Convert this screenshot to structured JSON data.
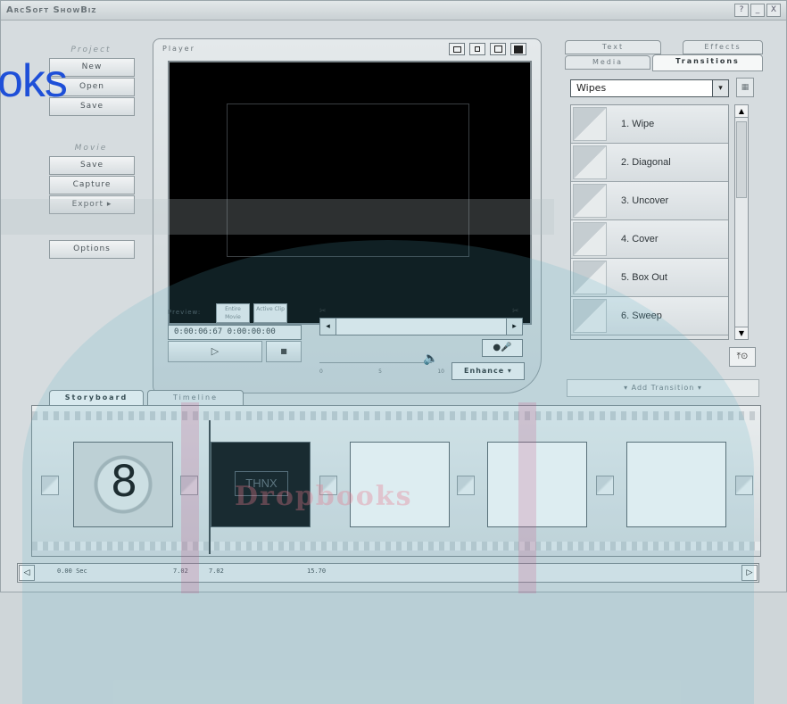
{
  "app": {
    "title": "ArcSoft ShowBiz"
  },
  "window_buttons": [
    "?",
    "_",
    "X"
  ],
  "watermark": {
    "logo_text": "oks",
    "drop_text": "Dropbooks"
  },
  "left_panel": {
    "project": {
      "label": "Project",
      "buttons": [
        "New",
        "Open",
        "Save"
      ]
    },
    "movie": {
      "label": "Movie",
      "buttons": [
        "Save",
        "Capture",
        "Export ▸"
      ]
    },
    "options_label": "Options"
  },
  "player": {
    "label": "Player",
    "preview_label": "Preview:",
    "preview_tabs": [
      "Entire Movie",
      "Active Clip"
    ],
    "timecode": "0:00:06:67   0:00:00:00",
    "play_symbol": "▷",
    "stop_symbol": "■",
    "volume_ticks": [
      "0",
      "5",
      "10"
    ],
    "enhance_label": "Enhance ▾"
  },
  "right_panel": {
    "tabs_top": [
      "Text",
      "Effects"
    ],
    "tabs_bottom": [
      "Media",
      "Transitions"
    ],
    "active_tab": "Transitions",
    "category": "Wipes",
    "transitions": [
      "1. Wipe",
      "2. Diagonal",
      "3. Uncover",
      "4. Cover",
      "5. Box Out",
      "6. Sweep"
    ],
    "add_transition_label": "▾ Add Transition ▾"
  },
  "storyboard": {
    "tabs": [
      "Storyboard",
      "Timeline"
    ],
    "active_tab": "Storyboard",
    "clips": [
      {
        "type": "countdown",
        "text": "8"
      },
      {
        "type": "title",
        "text": "THNX"
      },
      {
        "type": "empty",
        "text": ""
      },
      {
        "type": "empty",
        "text": ""
      },
      {
        "type": "empty",
        "text": ""
      }
    ]
  },
  "ruler": {
    "marks": [
      "0.00 Sec",
      "7.02",
      "7.02",
      "15.70"
    ]
  },
  "colors": {
    "accent_logo": "#1e4fd8",
    "panel_bg": "#d6dcdf",
    "screen_bg": "#000000"
  }
}
